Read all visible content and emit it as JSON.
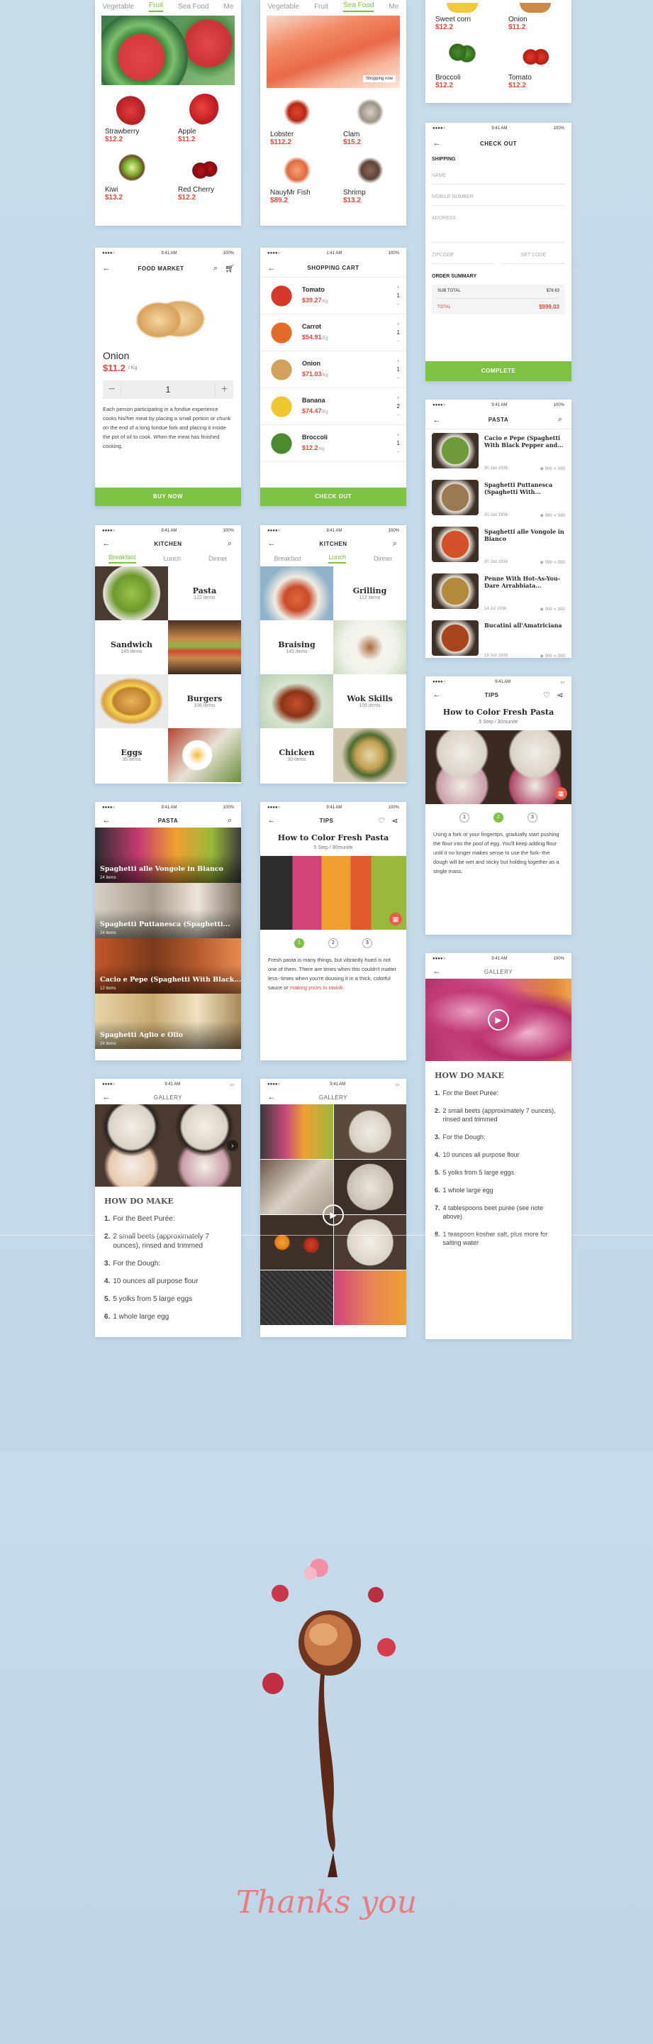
{
  "fruit_screen": {
    "tabs": [
      "Vegetable",
      "Fruit",
      "Sea Food",
      "Me"
    ],
    "items": [
      {
        "name": "Strawberry",
        "price": "$12.2"
      },
      {
        "name": "Apple",
        "price": "$11.2"
      },
      {
        "name": "Kiwi",
        "price": "$13.2"
      },
      {
        "name": "Red Cherry",
        "price": "$12.2"
      }
    ]
  },
  "seafood_screen": {
    "tabs": [
      "Vegetable",
      "Fruit",
      "Sea Food",
      "Me"
    ],
    "banner_button": "Shopping now",
    "items": [
      {
        "name": "Lobster",
        "price": "$112.2"
      },
      {
        "name": "Clam",
        "price": "$15.2"
      },
      {
        "name": "NauyMr Fish",
        "price": "$89.2"
      },
      {
        "name": "Shrimp",
        "price": "$13.2"
      }
    ]
  },
  "veg_screen": {
    "items": [
      {
        "name": "Sweet corn",
        "price": "$12.2"
      },
      {
        "name": "Onion",
        "price": "$11.2"
      },
      {
        "name": "Broccoli",
        "price": "$12.2"
      },
      {
        "name": "Tomato",
        "price": "$12.2"
      }
    ]
  },
  "checkout": {
    "status_left": "●●●●○",
    "status_time": "9:41 AM",
    "status_right": "100%",
    "title": "CHECK OUT",
    "section_shipping": "SHIPPING",
    "fields": [
      "NAME",
      "MOBILE NUMBER",
      "ADDRESS"
    ],
    "zipcode": "ZIPCODE",
    "city": "SET CODE",
    "section_summary": "ORDER SUMMARY",
    "subtotal_label": "SUB TOTAL",
    "subtotal_value": "$78.63",
    "total_label": "TOTAL",
    "total_value": "$999.03",
    "button": "COMPLETE"
  },
  "market": {
    "status_time": "9:41 AM",
    "status_right": "100%",
    "title": "FOOD MARKET",
    "product": "Onion",
    "price": "$11.2",
    "unit": "/ Kg",
    "qty": "1",
    "minus": "−",
    "plus": "+",
    "description": "Each person participating in a fondue experience cooks his/her meat by placing a small portion or chunk on the end of a long fondue fork and placing it inside the pot of oil to cook. When the meat has finished cooking,",
    "button": "BUY NOW"
  },
  "cart": {
    "status_time": "1:41 AM",
    "status_right": "100%",
    "title": "SHOPPING CART",
    "items": [
      {
        "name": "Tomato",
        "price": "$39.27",
        "unit": "/Kg",
        "qty": "1"
      },
      {
        "name": "Carrot",
        "price": "$54.91",
        "unit": "/Kg",
        "qty": "1"
      },
      {
        "name": "Onion",
        "price": "$71.03",
        "unit": "/Kg",
        "qty": "1"
      },
      {
        "name": "Banana",
        "price": "$74.47",
        "unit": "/Kg",
        "qty": "2"
      },
      {
        "name": "Broccoli",
        "price": "$12.2",
        "unit": "/Kg",
        "qty": "1"
      }
    ],
    "button": "CHECK OUT"
  },
  "pasta_list": {
    "status_time": "9:41 AM",
    "status_right": "100%",
    "title": "PASTA",
    "items": [
      {
        "title": "Cacio e Pepe (Spaghetti With Black Pepper and...",
        "date": "30 Jan 1936",
        "views": "999",
        "shares": "880"
      },
      {
        "title": "Spaghetti Puttanesca (Spaghetti With...",
        "date": "30 Jan 1936",
        "views": "999",
        "shares": "880"
      },
      {
        "title": "Spaghetti alle Vongole in Bianco",
        "date": "30 Jan 1936",
        "views": "999",
        "shares": "880"
      },
      {
        "title": "Penne With Hot-As-You-Dare Arrabbiata...",
        "date": "14 Jul 1936",
        "views": "999",
        "shares": "880"
      },
      {
        "title": "Bucatini all'Amatriciana",
        "date": "18 Jun 1936",
        "views": "999",
        "shares": "880"
      }
    ]
  },
  "kitchen1": {
    "status_time": "9:41 AM",
    "status_right": "100%",
    "title": "KITCHEN",
    "tabs": [
      "Breakfast",
      "Lunch",
      "Dinner"
    ],
    "cats": [
      {
        "name": "Pasta",
        "count": "122 items"
      },
      {
        "name": "Sandwich",
        "count": "145 items"
      },
      {
        "name": "Burgers",
        "count": "106 items"
      },
      {
        "name": "Eggs",
        "count": "35 items"
      }
    ]
  },
  "kitchen2": {
    "status_time": "9:41 AM",
    "status_right": "100%",
    "title": "KITCHEN",
    "tabs": [
      "Breakfast",
      "Lunch",
      "Dinner"
    ],
    "cats": [
      {
        "name": "Grilling",
        "count": "112 items"
      },
      {
        "name": "Braising",
        "count": "145 items"
      },
      {
        "name": "Wok Skills",
        "count": "106 items"
      },
      {
        "name": "Chicken",
        "count": "30 items"
      }
    ]
  },
  "tips1": {
    "status_time": "9:41 AM",
    "title": "TIPS",
    "recipe": "How to Color Fresh Pasta",
    "sub": "5 Step / 30munite",
    "steps": [
      "1",
      "2",
      "3"
    ],
    "body": "Using a fork or your fingertips, gradually start pushing the flour into the pool of egg. You'll keep adding flour until it no longer makes sense to use the fork--the dough will be wet and sticky but holding together as a single mass."
  },
  "pasta_cards": {
    "status_time": "9:41 AM",
    "status_right": "100%",
    "title": "PASTA",
    "cards": [
      {
        "title": "Spaghetti alle Vongole in Bianco",
        "count": "24 items"
      },
      {
        "title": "Spaghetti Puttanesca (Spaghetti...",
        "count": "24 items"
      },
      {
        "title": "Cacio e Pepe (Spaghetti With Black...",
        "count": "12 items"
      },
      {
        "title": "Spaghetti Aglio e Olio",
        "count": "24 items"
      }
    ]
  },
  "tips2": {
    "status_time": "9:41 AM",
    "status_right": "100%",
    "title": "TIPS",
    "recipe": "How to Color Fresh Pasta",
    "sub": "5 Step / 30munite",
    "steps": [
      "1",
      "2",
      "3"
    ],
    "body": "Fresh pasta is many things, but vibrantly hued is not one of them. There are times when this couldn't matter less--times when you're dousing it in a thick, colorful sauce or",
    "link": "making yours in ravioli."
  },
  "gallery1": {
    "status_time": "9:41 AM",
    "status_right": "100%",
    "title": "GALLERY",
    "heading": "HOW DO MAKE",
    "items": [
      "For the Beet Purée:",
      "2 small beets (approximately 7 ounces), rinsed and trimmed",
      "For the Dough:",
      "10 ounces all purpose flour",
      "5 yolks from 5 large eggs",
      "1 whole large egg",
      "4 tablespoons beet purée (see note above)",
      "1 teaspoon kosher salt, plus more for salting water"
    ]
  },
  "gallery2": {
    "status_time": "9:41 AM",
    "title": "GALLERY",
    "heading": "HOW DO MAKE",
    "items": [
      "For the Beet Purée:",
      "2 small beets (approximately 7 ounces), rinsed and trimmed",
      "For the Dough:",
      "10 ounces all purpose flour",
      "5 yolks from 5 large eggs",
      "1 whole large egg"
    ]
  },
  "gallery3": {
    "status_time": "9:41 AM",
    "title": "GALLERY"
  },
  "thanks": "Thanks you",
  "colors": {
    "accent": "#7dc242",
    "price": "#e8473b",
    "background": "#c8dbe9"
  }
}
